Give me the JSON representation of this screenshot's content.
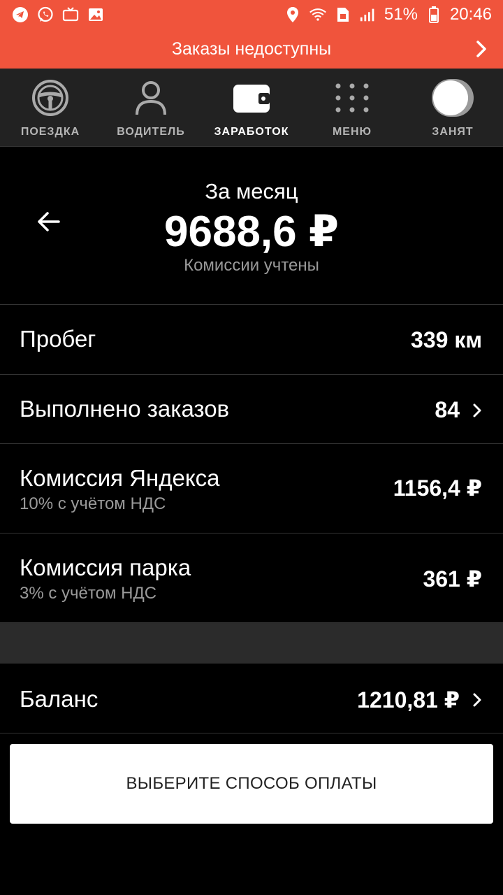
{
  "status_bar": {
    "battery": "51%",
    "time": "20:46",
    "icons_left": [
      "telegram-icon",
      "whatsapp-icon",
      "tv-icon",
      "gallery-icon"
    ],
    "icons_right": [
      "location-icon",
      "wifi-icon",
      "signal-icon",
      "battery-icon"
    ]
  },
  "banner": {
    "text": "Заказы недоступны"
  },
  "nav": {
    "items": [
      {
        "label": "ПОЕЗДКА",
        "icon": "steering-wheel-icon"
      },
      {
        "label": "ВОДИТЕЛЬ",
        "icon": "person-icon"
      },
      {
        "label": "ЗАРАБОТОК",
        "icon": "wallet-icon",
        "active": true
      },
      {
        "label": "МЕНЮ",
        "icon": "grid-icon"
      },
      {
        "label": "ЗАНЯТ",
        "icon": "toggle-switch"
      }
    ]
  },
  "summary": {
    "period": "За месяц",
    "amount": "9688,6 ₽",
    "note": "Комиссии учтены"
  },
  "rows": {
    "mileage": {
      "title": "Пробег",
      "value": "339 км"
    },
    "orders": {
      "title": "Выполнено заказов",
      "value": "84"
    },
    "yandex_commission": {
      "title": "Комиссия Яндекса",
      "subtitle": "10% с учётом НДС",
      "value": "1156,4 ₽"
    },
    "park_commission": {
      "title": "Комиссия парка",
      "subtitle": "3% с учётом НДС",
      "value": "361 ₽"
    },
    "balance": {
      "title": "Баланс",
      "value": "1210,81 ₽"
    }
  },
  "payment_button": {
    "label": "ВЫБЕРИТЕ СПОСОБ ОПЛАТЫ"
  },
  "colors": {
    "accent": "#f0543c",
    "background": "#000000",
    "nav_bg": "#222222"
  }
}
